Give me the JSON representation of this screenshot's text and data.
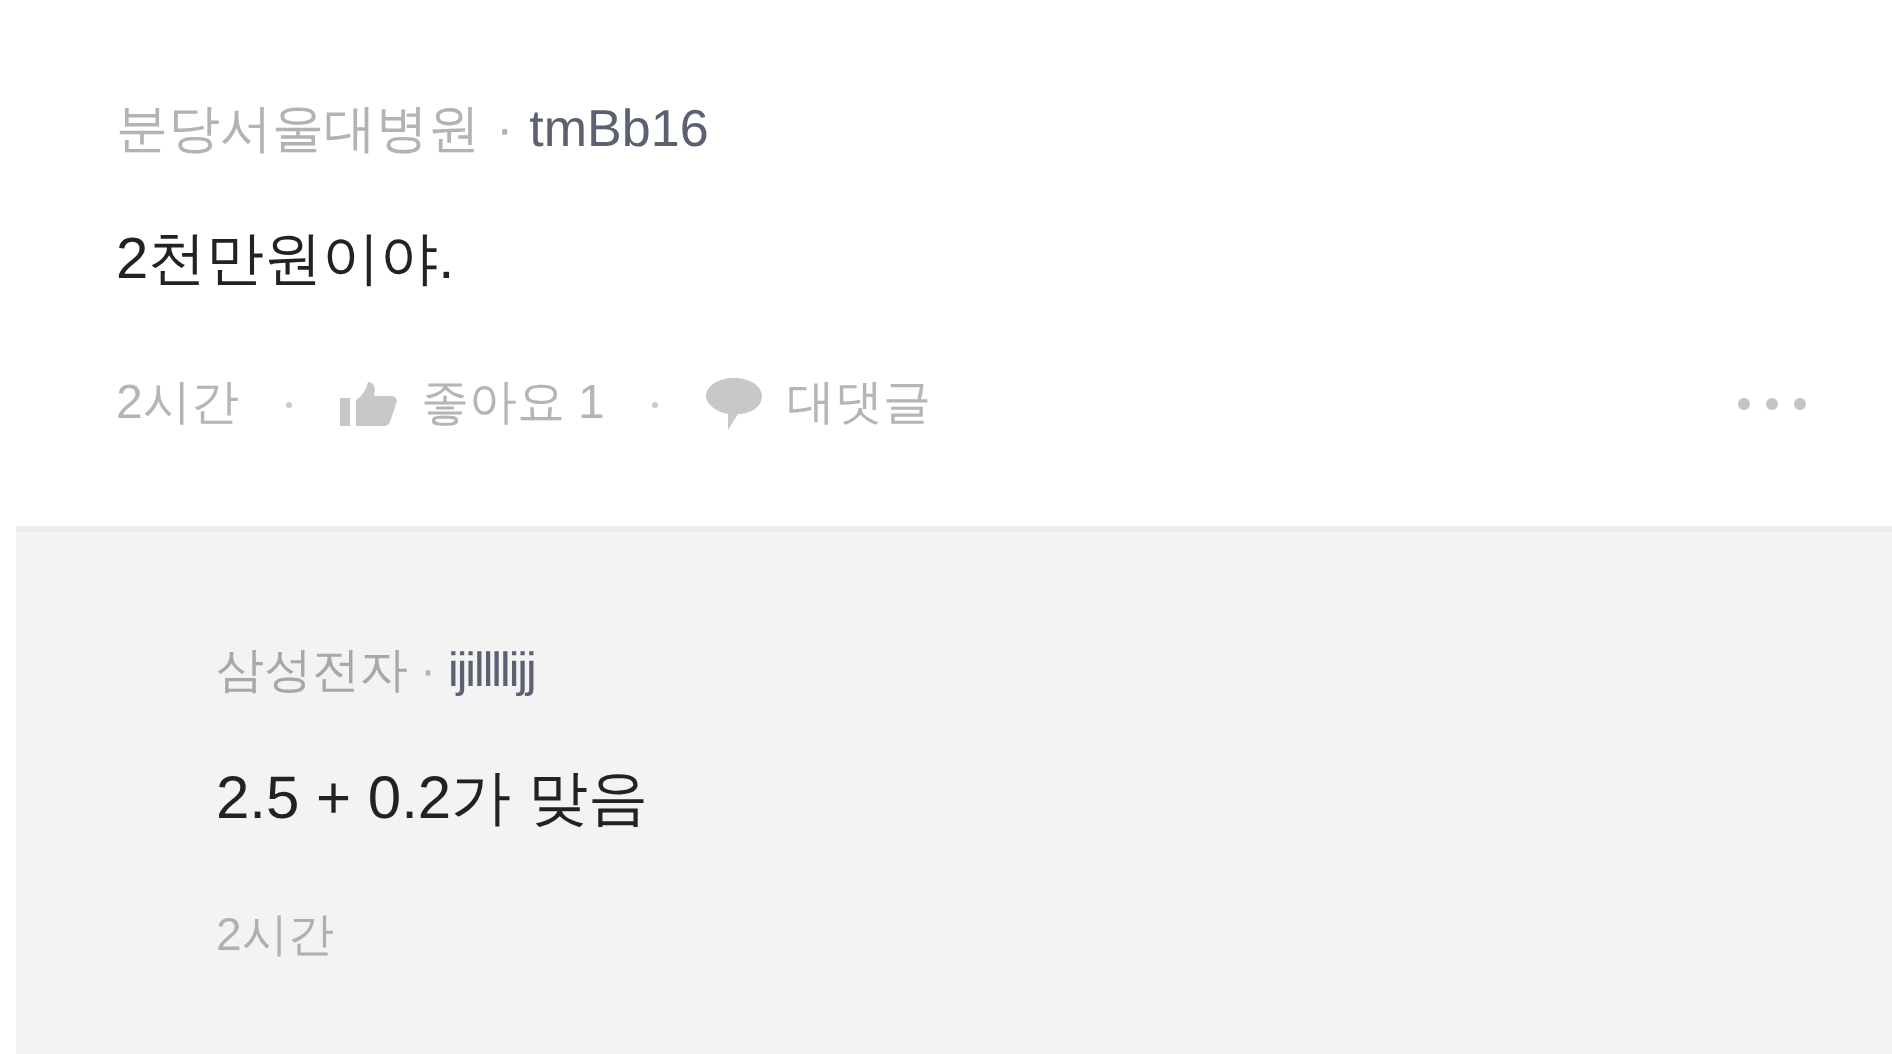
{
  "comment": {
    "author": "분당서울대병원",
    "separator": "·",
    "user": "tmBb16",
    "body": "2천만원이야.",
    "time": "2시간",
    "like_label": "좋아요 1",
    "reply_label": "대댓글"
  },
  "reply": {
    "author": "삼성전자",
    "separator": "·",
    "user": "ijillllijj",
    "body": "2.5 + 0.2가 맞음",
    "time": "2시간"
  }
}
